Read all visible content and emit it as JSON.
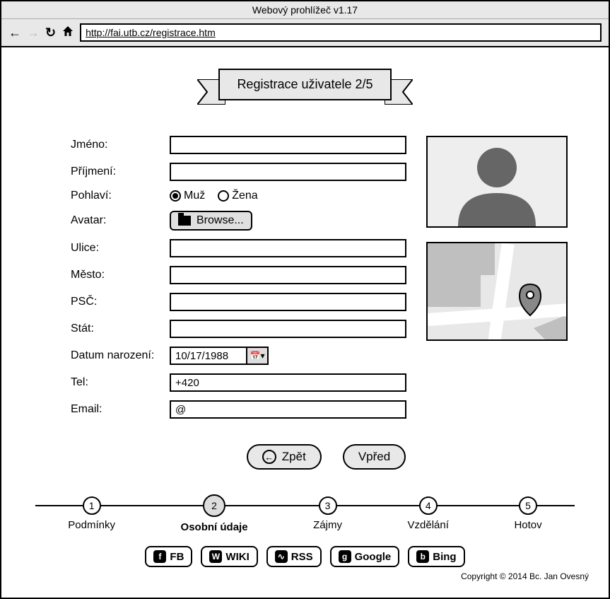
{
  "window": {
    "title": "Webový prohlížeč v1.17",
    "url": "http://fai.utb.cz/registrace.htm"
  },
  "banner": {
    "title": "Registrace uživatele 2/5"
  },
  "form": {
    "firstname": {
      "label": "Jméno:",
      "value": ""
    },
    "lastname": {
      "label": "Příjmení:",
      "value": ""
    },
    "gender": {
      "label": "Pohlaví:",
      "male": "Muž",
      "female": "Žena",
      "selected": "male"
    },
    "avatar": {
      "label": "Avatar:",
      "browse": "Browse..."
    },
    "street": {
      "label": "Ulice:",
      "value": ""
    },
    "city": {
      "label": "Město:",
      "value": ""
    },
    "zip": {
      "label": "PSČ:",
      "value": ""
    },
    "country": {
      "label": "Stát:",
      "value": ""
    },
    "dob": {
      "label": "Datum narození:",
      "value": "10/17/1988"
    },
    "tel": {
      "label": "Tel:",
      "value": "+420"
    },
    "email": {
      "label": "Email:",
      "value": "@"
    }
  },
  "nav": {
    "back": "Zpět",
    "forward": "Vpřed"
  },
  "steps": [
    {
      "num": "1",
      "label": "Podmínky"
    },
    {
      "num": "2",
      "label": "Osobní údaje"
    },
    {
      "num": "3",
      "label": "Zájmy"
    },
    {
      "num": "4",
      "label": "Vzdělání"
    },
    {
      "num": "5",
      "label": "Hotov"
    }
  ],
  "active_step": 1,
  "social": [
    {
      "icon": "f",
      "label": "FB"
    },
    {
      "icon": "W",
      "label": "WIKI"
    },
    {
      "icon": "∿",
      "label": "RSS"
    },
    {
      "icon": "g",
      "label": "Google"
    },
    {
      "icon": "b",
      "label": "Bing"
    }
  ],
  "copyright": "Copyright © 2014 Bc. Jan Ovesný"
}
